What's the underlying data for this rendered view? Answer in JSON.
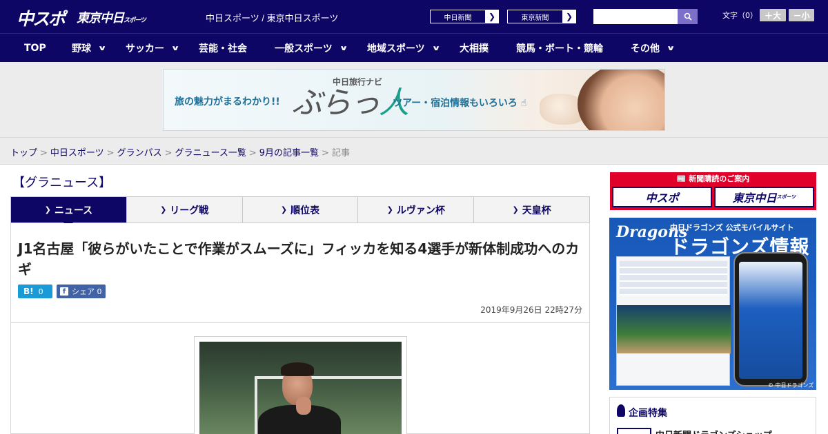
{
  "header": {
    "logo_main": "中スポ",
    "logo_tokyo": "東京中日",
    "logo_tokyo_suffix": "スポーツ",
    "site_title": "中日スポーツ / 東京中日スポーツ",
    "links": [
      {
        "label": "中日新聞"
      },
      {
        "label": "東京新聞"
      }
    ],
    "search": {
      "placeholder": ""
    },
    "font_size_label": "文字（0）",
    "font_larger": "＋大",
    "font_smaller": "－小"
  },
  "nav": {
    "items": [
      {
        "label": "TOP",
        "has_menu": false
      },
      {
        "label": "野球",
        "has_menu": true
      },
      {
        "label": "サッカー",
        "has_menu": true
      },
      {
        "label": "芸能・社会",
        "has_menu": false
      },
      {
        "label": "一般スポーツ",
        "has_menu": true
      },
      {
        "label": "地域スポーツ",
        "has_menu": true
      },
      {
        "label": "大相撲",
        "has_menu": false
      },
      {
        "label": "競馬・ボート・競輪",
        "has_menu": false
      },
      {
        "label": "その他",
        "has_menu": true
      }
    ]
  },
  "banner": {
    "left_text": "旅の魅力がまるわかり!!",
    "small_title": "中日旅行ナビ",
    "logo_a": "ぶらっ",
    "logo_b": "人",
    "right_text": "ツアー・宿泊情報もいろいろ"
  },
  "breadcrumb": {
    "items": [
      "トップ",
      "中日スポーツ",
      "グランパス",
      "グラニュース一覧",
      "9月の記事一覧"
    ],
    "current": "記事",
    "separator": ">"
  },
  "section": {
    "title": "【グラニュース】"
  },
  "tabs": [
    {
      "label": "ニュース",
      "active": true
    },
    {
      "label": "リーグ戦",
      "active": false
    },
    {
      "label": "順位表",
      "active": false
    },
    {
      "label": "ルヴァン杯",
      "active": false
    },
    {
      "label": "天皇杯",
      "active": false
    }
  ],
  "article": {
    "headline": "J1名古屋「彼らがいたことで作業がスムーズに」フィッカを知る4選手が新体制成功へのカギ",
    "hatena": {
      "icon": "B!",
      "count": "0"
    },
    "facebook": {
      "icon": "f",
      "label": "シェア",
      "count": "0"
    },
    "date": "2019年9月26日 22時27分"
  },
  "sidebar": {
    "subscription": {
      "heading": "新聞購読のご案内",
      "left": "中スポ",
      "right": "東京中日",
      "right_suffix": "スポーツ"
    },
    "dragons_ad": {
      "logo": "Dragons",
      "subtitle": "中日ドラゴンズ 公式モバイルサイト",
      "title": "ドラゴンズ情報",
      "copyright": "© 中日ドラゴンズ"
    },
    "feature": {
      "title": "企画特集",
      "item": "中日新聞ドラゴンズショップ"
    }
  },
  "colors": {
    "brand_navy": "#0e0665",
    "accent_red": "#e0002a",
    "hatena_blue": "#1b9ad8",
    "facebook_blue": "#4262a6"
  }
}
